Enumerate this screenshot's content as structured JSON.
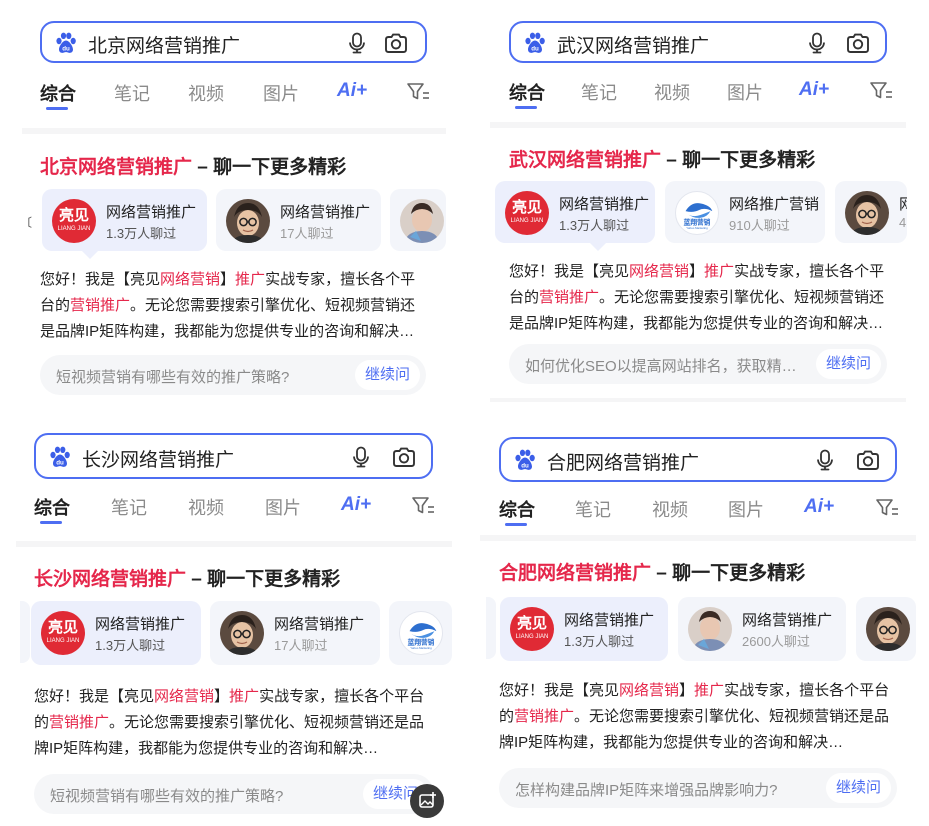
{
  "colors": {
    "accent": "#4e6ef2",
    "keyword": "#e5274b"
  },
  "tabs": {
    "items": [
      "综合",
      "笔记",
      "视频",
      "图片"
    ],
    "ai_label": "Ai+"
  },
  "headline_suffix": " – 聊一下更多精彩",
  "intro": {
    "p1": "您好！我是【亮见",
    "kw1": "网络营销",
    "p2": "】",
    "kw2": "推广",
    "p3": "实战专家，擅长各个平台的",
    "kw3": "营销推广",
    "p4": "。无论您需要搜索引擎优化、短视频营销还是品牌IP矩阵构建，我都能为您提供专业的咨询和解决…"
  },
  "brand_avatar": {
    "line1": "亮见",
    "line2": "LIANG JIAN"
  },
  "continue_label": "继续问",
  "panels": [
    {
      "query": "北京网络营销推广",
      "headline_kw": "北京网络营销推广",
      "cards": [
        {
          "name": "网络营销推广",
          "count": "1.3万人聊过"
        },
        {
          "name": "网络营销推广",
          "count": "17人聊过"
        }
      ],
      "question": "短视频营销有哪些有效的推广策略?"
    },
    {
      "query": "武汉网络营销推广",
      "headline_kw": "武汉网络营销推广",
      "cards": [
        {
          "name": "网络营销推广",
          "count": "1.3万人聊过"
        },
        {
          "name": "网络推广营销",
          "count": "910人聊过"
        },
        {
          "name": "网",
          "count": "4"
        }
      ],
      "question": "如何优化SEO以提高网站排名，获取精…"
    },
    {
      "query": "长沙网络营销推广",
      "headline_kw": "长沙网络营销推广",
      "cards": [
        {
          "name": "网络营销推广",
          "count": "1.3万人聊过"
        },
        {
          "name": "网络营销推广",
          "count": "17人聊过"
        }
      ],
      "question": "短视频营销有哪些有效的推广策略?"
    },
    {
      "query": "合肥网络营销推广",
      "headline_kw": "合肥网络营销推广",
      "cards": [
        {
          "name": "网络营销推广",
          "count": "1.3万人聊过"
        },
        {
          "name": "网络营销推广",
          "count": "2600人聊过"
        }
      ],
      "question": "怎样构建品牌IP矩阵来增强品牌影响力?"
    }
  ],
  "icons": [
    "baidu-paw-icon",
    "microphone-icon",
    "camera-icon",
    "filter-icon",
    "ai-sparkle-icon",
    "add-image-icon"
  ]
}
